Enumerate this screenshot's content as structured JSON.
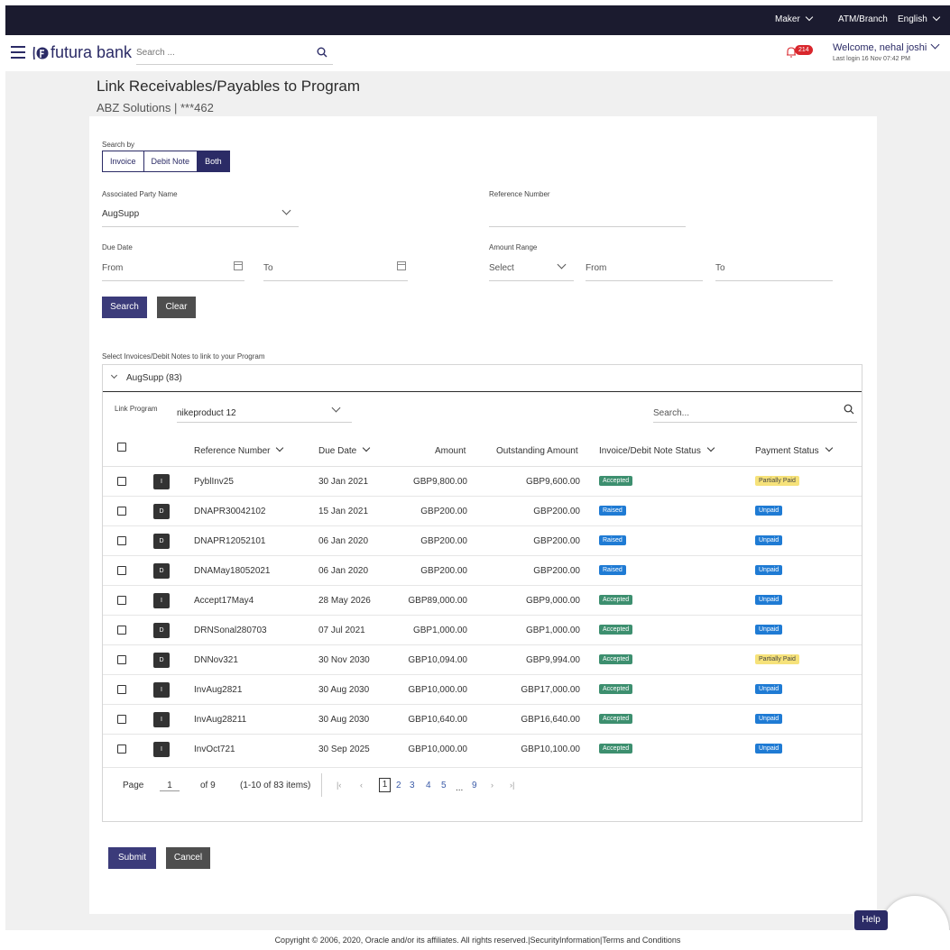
{
  "topbar": {
    "role": "Maker",
    "location": "ATM/Branch",
    "language": "English"
  },
  "header": {
    "brand": "futura bank",
    "search_placeholder": "Search ...",
    "notification_count": "214",
    "welcome": "Welcome, nehal joshi",
    "last_login": "Last login 16 Nov 07:42 PM"
  },
  "page": {
    "title": "Link Receivables/Payables to Program",
    "subtitle": "ABZ Solutions | ***462"
  },
  "form": {
    "search_by_label": "Search by",
    "search_by_options": [
      "Invoice",
      "Debit Note",
      "Both"
    ],
    "search_by_selected": "Both",
    "party_label": "Associated Party Name",
    "party_value": "AugSupp",
    "ref_label": "Reference Number",
    "ref_value": "",
    "due_label": "Due Date",
    "due_from": "From",
    "due_to": "To",
    "amount_label": "Amount Range",
    "amount_select": "Select",
    "amount_from": "From",
    "amount_to": "To",
    "search_btn": "Search",
    "clear_btn": "Clear"
  },
  "results": {
    "section_title": "Select Invoices/Debit Notes to link to your Program",
    "group_title": "AugSupp (83)",
    "link_program_label": "Link Program",
    "link_program_value": "nikeproduct 12",
    "table_search_placeholder": "Search...",
    "columns": [
      "Reference Number",
      "Due Date",
      "Amount",
      "Outstanding Amount",
      "Invoice/Debit Note Status",
      "Payment Status"
    ],
    "rows": [
      {
        "type": "I",
        "ref": "PyblInv25",
        "due": "30 Jan 2021",
        "amount": "GBP9,800.00",
        "outstanding": "GBP9,600.00",
        "status": "Accepted",
        "payment": "Partially Paid"
      },
      {
        "type": "D",
        "ref": "DNAPR30042102",
        "due": "15 Jan 2021",
        "amount": "GBP200.00",
        "outstanding": "GBP200.00",
        "status": "Raised",
        "payment": "Unpaid"
      },
      {
        "type": "D",
        "ref": "DNAPR12052101",
        "due": "06 Jan 2020",
        "amount": "GBP200.00",
        "outstanding": "GBP200.00",
        "status": "Raised",
        "payment": "Unpaid"
      },
      {
        "type": "D",
        "ref": "DNAMay18052021",
        "due": "06 Jan 2020",
        "amount": "GBP200.00",
        "outstanding": "GBP200.00",
        "status": "Raised",
        "payment": "Unpaid"
      },
      {
        "type": "I",
        "ref": "Accept17May4",
        "due": "28 May 2026",
        "amount": "GBP89,000.00",
        "outstanding": "GBP9,000.00",
        "status": "Accepted",
        "payment": "Unpaid"
      },
      {
        "type": "D",
        "ref": "DRNSonal280703",
        "due": "07 Jul 2021",
        "amount": "GBP1,000.00",
        "outstanding": "GBP1,000.00",
        "status": "Accepted",
        "payment": "Unpaid"
      },
      {
        "type": "D",
        "ref": "DNNov321",
        "due": "30 Nov 2030",
        "amount": "GBP10,094.00",
        "outstanding": "GBP9,994.00",
        "status": "Accepted",
        "payment": "Partially Paid"
      },
      {
        "type": "I",
        "ref": "InvAug2821",
        "due": "30 Aug 2030",
        "amount": "GBP10,000.00",
        "outstanding": "GBP17,000.00",
        "status": "Accepted",
        "payment": "Unpaid"
      },
      {
        "type": "I",
        "ref": "InvAug28211",
        "due": "30 Aug 2030",
        "amount": "GBP10,640.00",
        "outstanding": "GBP16,640.00",
        "status": "Accepted",
        "payment": "Unpaid"
      },
      {
        "type": "I",
        "ref": "InvOct721",
        "due": "30 Sep 2025",
        "amount": "GBP10,000.00",
        "outstanding": "GBP10,100.00",
        "status": "Accepted",
        "payment": "Unpaid"
      }
    ],
    "pager": {
      "page_label": "Page",
      "page_value": "1",
      "of_pages": "of 9",
      "items_info": "(1-10 of 83 items)",
      "pages": [
        "2",
        "3",
        "4",
        "5",
        "9"
      ],
      "current": "1",
      "ellipsis": "..."
    }
  },
  "actions": {
    "submit": "Submit",
    "cancel": "Cancel"
  },
  "footer": {
    "text": "Copyright © 2006, 2020, Oracle and/or its affiliates. All rights reserved.|SecurityInformation|Terms and Conditions"
  },
  "help": "Help",
  "colors": {
    "brand": "#2b2b66",
    "accepted": "#3d8f6f",
    "raised": "#1f7bd4",
    "unpaid": "#1f7bd4",
    "partially_paid": "#f6e27a"
  }
}
